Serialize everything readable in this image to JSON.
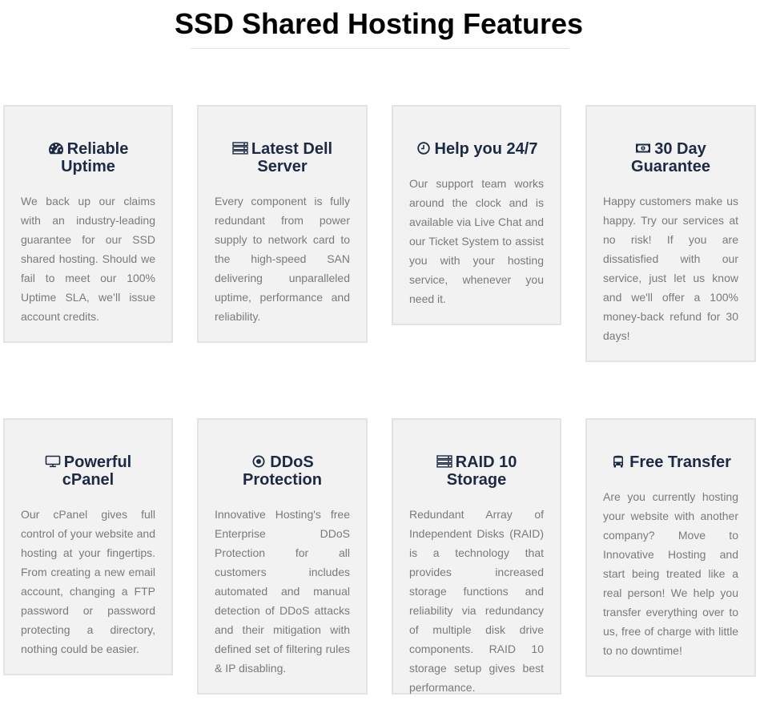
{
  "page": {
    "title": "SSD Shared Hosting Features"
  },
  "features": [
    {
      "icon": "dashboard-gauge-icon",
      "title": "Reliable Uptime",
      "text": "We back up our claims with an industry-leading guarantee for our SSD shared hosting. Should we fail to meet our 100% Uptime SLA, we’ll issue account credits."
    },
    {
      "icon": "server-icon",
      "title": "Latest Dell Server",
      "text": "Every component is fully redundant from power supply to network card to the high-speed SAN delivering unparalleled uptime, performance and reliability."
    },
    {
      "icon": "clock-icon",
      "title": "Help you 24/7",
      "text": "Our support team works around the clock and is available via Live Chat and our Ticket System to assist you with your hosting service, whenever you need it."
    },
    {
      "icon": "money-bill-icon",
      "title": "30 Day Guarantee",
      "text": "Happy customers make us happy. Try our services at no risk! If you are dissatisfied with our service, just let us know and we'll offer a 100% money-back refund for 30 days!"
    },
    {
      "icon": "desktop-monitor-icon",
      "title": "Powerful cPanel",
      "text": "Our cPanel gives full control of your website and hosting at your fingertips. From creating a new email account, changing a FTP password or password protecting a directory, nothing could be easier."
    },
    {
      "icon": "dot-circle-icon",
      "title": "DDoS Protection",
      "text": "Innovative Hosting's free Enterprise DDoS Protection for all customers includes automated and manual detection of DDoS attacks and their mitigation with defined set of filtering rules & IP disabling."
    },
    {
      "icon": "server-icon",
      "title": "RAID 10 Storage",
      "text": "Redundant Array of Independent Disks (RAID) is a technology that provides increased storage functions and reliability via redundancy of multiple disk drive components. RAID 10 storage setup gives best performance."
    },
    {
      "icon": "bus-icon",
      "title": "Free Transfer",
      "text": "Are you currently hosting your website with another company? Move to Innovative Hosting and start being treated like a real person! We help you transfer everything over to us, free of charge with little to no downtime!"
    }
  ],
  "colors": {
    "card_background": "#f2f2f2",
    "card_border": "#e3e3e3",
    "heading": "#1d2a44",
    "body_text": "#7a7a7a"
  }
}
